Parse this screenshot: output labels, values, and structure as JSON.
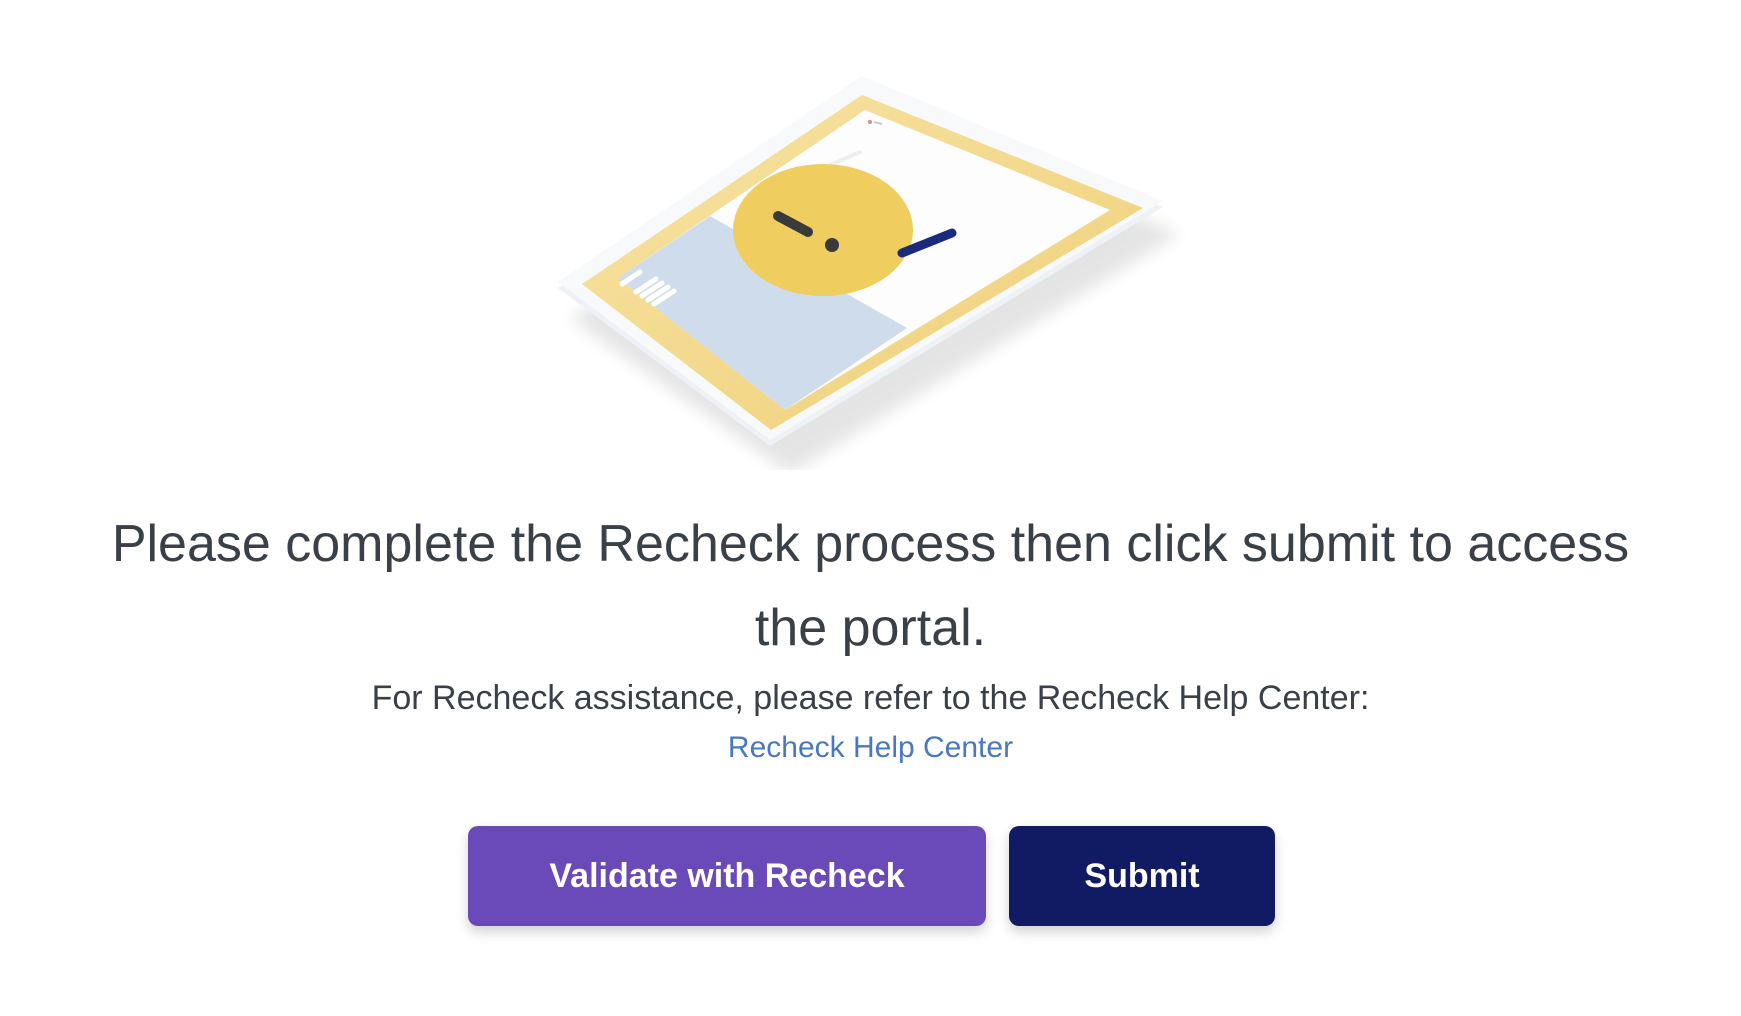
{
  "message": {
    "line1": "Please complete the Recheck process then click submit to access",
    "line2": "the portal."
  },
  "assistance": {
    "text": "For Recheck assistance, please refer to the Recheck Help Center:",
    "link_label": "Recheck Help Center"
  },
  "buttons": {
    "validate_label": "Validate with Recheck",
    "submit_label": "Submit"
  },
  "illustration": {
    "icon": "tablet-warning-illustration",
    "colors": {
      "frame": "#f1d27a",
      "warning_circle": "#efcd5f",
      "side_panel": "#cfdceb",
      "accent_bar": "#1b2a7a"
    }
  },
  "colors": {
    "text": "#3a4048",
    "link": "#4a78c0",
    "validate_button": "#6a49b8",
    "submit_button": "#111b63"
  }
}
